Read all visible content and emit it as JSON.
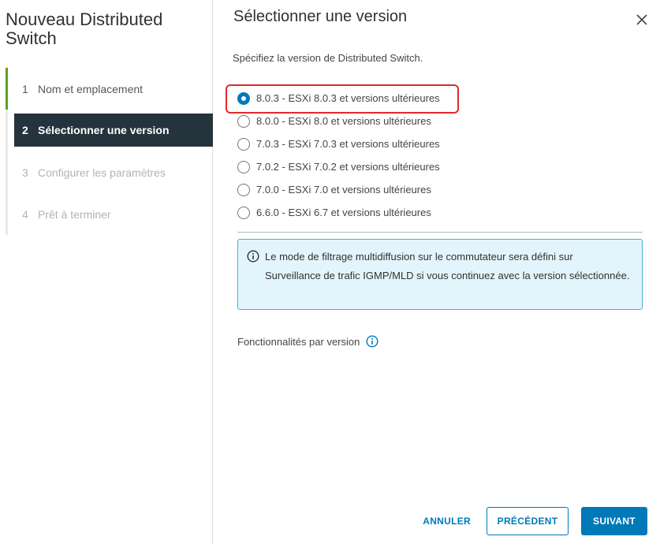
{
  "wizard": {
    "title": "Nouveau Distributed Switch",
    "steps": [
      {
        "num": "1",
        "label": "Nom et emplacement",
        "state": "done"
      },
      {
        "num": "2",
        "label": "Sélectionner une version",
        "state": "active"
      },
      {
        "num": "3",
        "label": "Configurer les paramètres",
        "state": "disabled"
      },
      {
        "num": "4",
        "label": "Prêt à terminer",
        "state": "disabled"
      }
    ]
  },
  "main": {
    "title": "Sélectionner une version",
    "subtitle": "Spécifiez la version de Distributed Switch.",
    "versions": [
      {
        "label": "8.0.3 - ESXi 8.0.3 et versions ultérieures",
        "selected": true
      },
      {
        "label": "8.0.0 - ESXi 8.0 et versions ultérieures",
        "selected": false
      },
      {
        "label": "7.0.3 - ESXi 7.0.3 et versions ultérieures",
        "selected": false
      },
      {
        "label": "7.0.2 - ESXi 7.0.2 et versions ultérieures",
        "selected": false
      },
      {
        "label": "7.0.0 - ESXi 7.0 et versions ultérieures",
        "selected": false
      },
      {
        "label": "6.6.0 - ESXi 6.7 et versions ultérieures",
        "selected": false
      }
    ],
    "alert": {
      "icon": "info-icon",
      "text": "Le mode de filtrage multidiffusion sur le commutateur sera défini sur Surveillance de trafic IGMP/MLD si vous continuez avec la version sélectionnée."
    },
    "features_label": "Fonctionnalités par version"
  },
  "footer": {
    "cancel": "ANNULER",
    "previous": "PRÉCÉDENT",
    "next": "SUIVANT"
  },
  "colors": {
    "accent": "#0079b8",
    "active_step_bg": "#25333d",
    "done_step": "#5aa220",
    "highlight": "#e02b2b",
    "alert_bg": "#e3f5fc"
  }
}
